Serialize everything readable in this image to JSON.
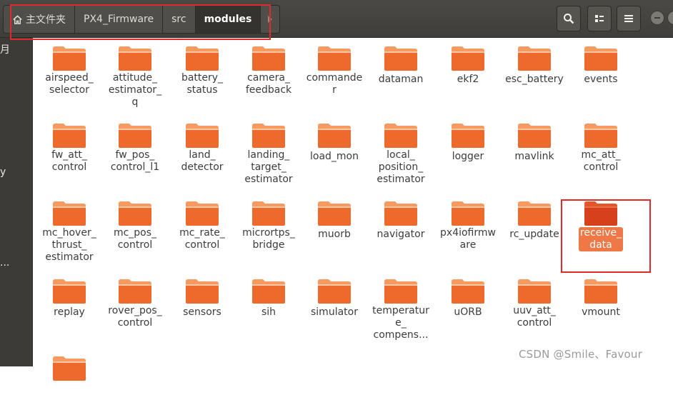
{
  "breadcrumb": [
    "主文件夹",
    "PX4_Firmware",
    "src",
    "modules"
  ],
  "sidebar_glyphs": [
    "月",
    "y",
    "..."
  ],
  "header_buttons": [
    "search-icon",
    "view-list-icon",
    "menu-icon"
  ],
  "folders": [
    "airspeed_\nselector",
    "attitude_\nestimator_\nq",
    "battery_\nstatus",
    "camera_\nfeedback",
    "commande\nr",
    "dataman",
    "ekf2",
    "esc_battery",
    "events",
    "fw_att_\ncontrol",
    "fw_pos_\ncontrol_l1",
    "land_\ndetector",
    "landing_\ntarget_\nestimator",
    "load_mon",
    "local_\nposition_\nestimator",
    "logger",
    "mavlink",
    "mc_att_\ncontrol",
    "mc_hover_\nthrust_\nestimator",
    "mc_pos_\ncontrol",
    "mc_rate_\ncontrol",
    "micrortps_\nbridge",
    "muorb",
    "navigator",
    "px4iofirmw\nare",
    "rc_update",
    "receive_\ndata",
    "replay",
    "rover_pos_\ncontrol",
    "sensors",
    "sih",
    "simulator",
    "temperatur\ne_\ncompens...",
    "uORB",
    "uuv_att_\ncontrol",
    "vmount",
    ""
  ],
  "selected_folder": "receive_\ndata",
  "colors": {
    "folder_top": "#f79a60",
    "folder_body": "#ee6a2c",
    "folder_selected": "#d6401a",
    "selection_bg": "#f07746",
    "annotation": "#e02a2a"
  },
  "watermark": "CSDN @Smile、Favour"
}
